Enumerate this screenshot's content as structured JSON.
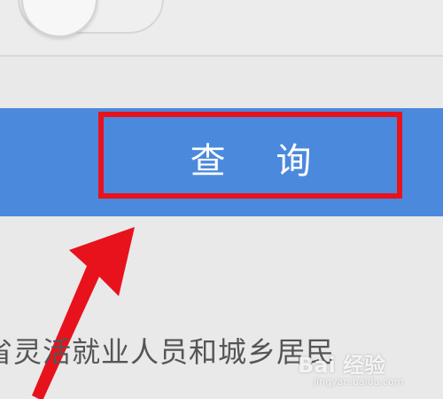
{
  "query_button": {
    "label": "查 询"
  },
  "content": {
    "text": "省灵活就业人员和城乡居民"
  },
  "watermark": {
    "brand": "Bai 经验",
    "url": "jingyan.baidu.com"
  },
  "colors": {
    "background": "#e9e9e9",
    "bar_blue": "#4b89dc",
    "highlight_red": "#e8121c",
    "text_gray": "#555555"
  }
}
